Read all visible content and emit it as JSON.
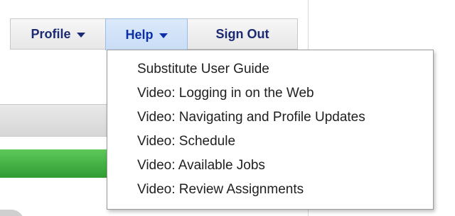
{
  "nav": {
    "profile_label": "Profile",
    "help_label": "Help",
    "signout_label": "Sign Out"
  },
  "help_menu": {
    "items": [
      {
        "label": "Substitute User Guide"
      },
      {
        "label": "Video: Logging in on the Web"
      },
      {
        "label": "Video: Navigating and Profile Updates"
      },
      {
        "label": "Video: Schedule"
      },
      {
        "label": "Video: Available Jobs"
      },
      {
        "label": "Video: Review Assignments"
      }
    ]
  },
  "icons": {
    "profile_caret": "caret-down-icon",
    "help_caret": "caret-down-icon"
  },
  "colors": {
    "nav_text": "#1b2a72",
    "help_active_bg": "#cfe2f8",
    "green_bar": "#3aa83c"
  }
}
